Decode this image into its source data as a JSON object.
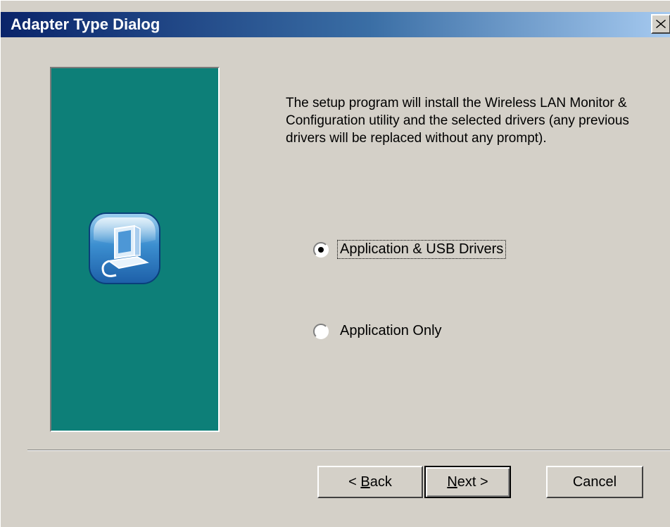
{
  "window": {
    "title": "Adapter Type Dialog"
  },
  "titlebar": {
    "close_icon": "close-icon"
  },
  "side_panel": {
    "color": "#0d7f78",
    "icon": "setup-computer-icon"
  },
  "main": {
    "description": "The setup program will install the Wireless LAN Monitor & Configuration utility and the selected drivers (any previous drivers will be replaced without any prompt).",
    "options": [
      {
        "label": "Application & USB Drivers",
        "selected": true
      },
      {
        "label": "Application Only",
        "selected": false
      }
    ]
  },
  "buttons": {
    "back_prefix": "< ",
    "back_mnemonic": "B",
    "back_rest": "ack",
    "next_mnemonic": "N",
    "next_rest": "ext >",
    "cancel": "Cancel"
  }
}
